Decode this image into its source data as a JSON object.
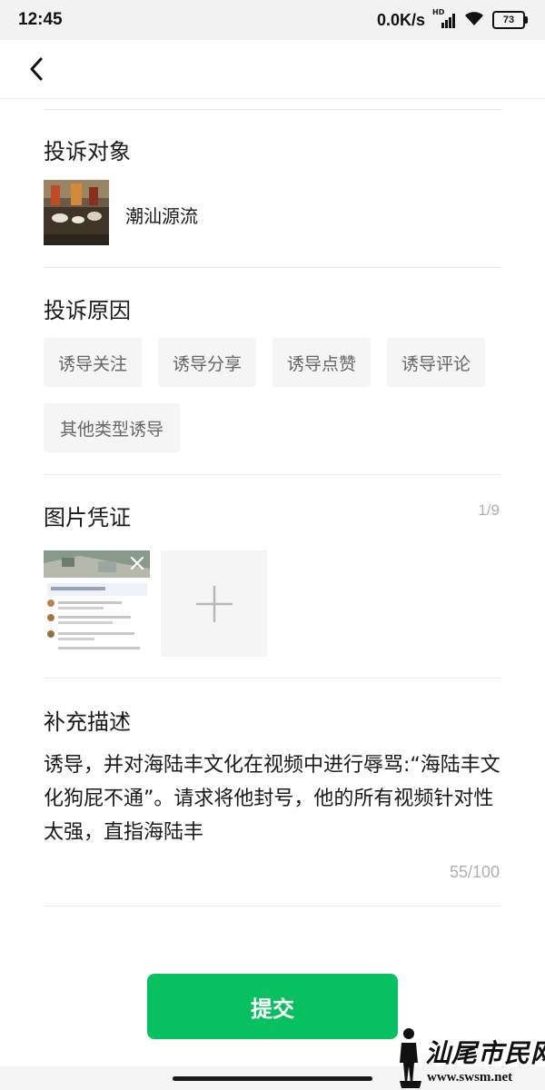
{
  "status_bar": {
    "time": "12:45",
    "network_speed": "0.0K/s",
    "signal_label": "HD",
    "battery": "73",
    "icons": [
      "signal-icon",
      "wifi-icon",
      "battery-icon"
    ]
  },
  "nav": {
    "back_icon": "chevron-left-icon"
  },
  "target": {
    "title": "投诉对象",
    "name": "潮汕源流"
  },
  "reason": {
    "title": "投诉原因",
    "options": [
      "诱导关注",
      "诱导分享",
      "诱导点赞",
      "诱导评论",
      "其他类型诱导"
    ]
  },
  "evidence": {
    "title": "图片凭证",
    "count": "1/9",
    "add_icon": "plus-icon",
    "remove_icon": "close-icon"
  },
  "description": {
    "title": "补充描述",
    "text": "诱导，并对海陆丰文化在视频中进行辱骂:“海陆丰文化狗屁不通”。请求将他封号，他的所有视频针对性太强，直指海陆丰",
    "count": "55/100"
  },
  "submit_label": "提交",
  "watermark": {
    "text": "汕尾市民网",
    "url": "www.swsm.net"
  },
  "colors": {
    "accent": "#07c160",
    "chip_bg": "#f5f5f5",
    "divider": "#e8e8e8"
  }
}
